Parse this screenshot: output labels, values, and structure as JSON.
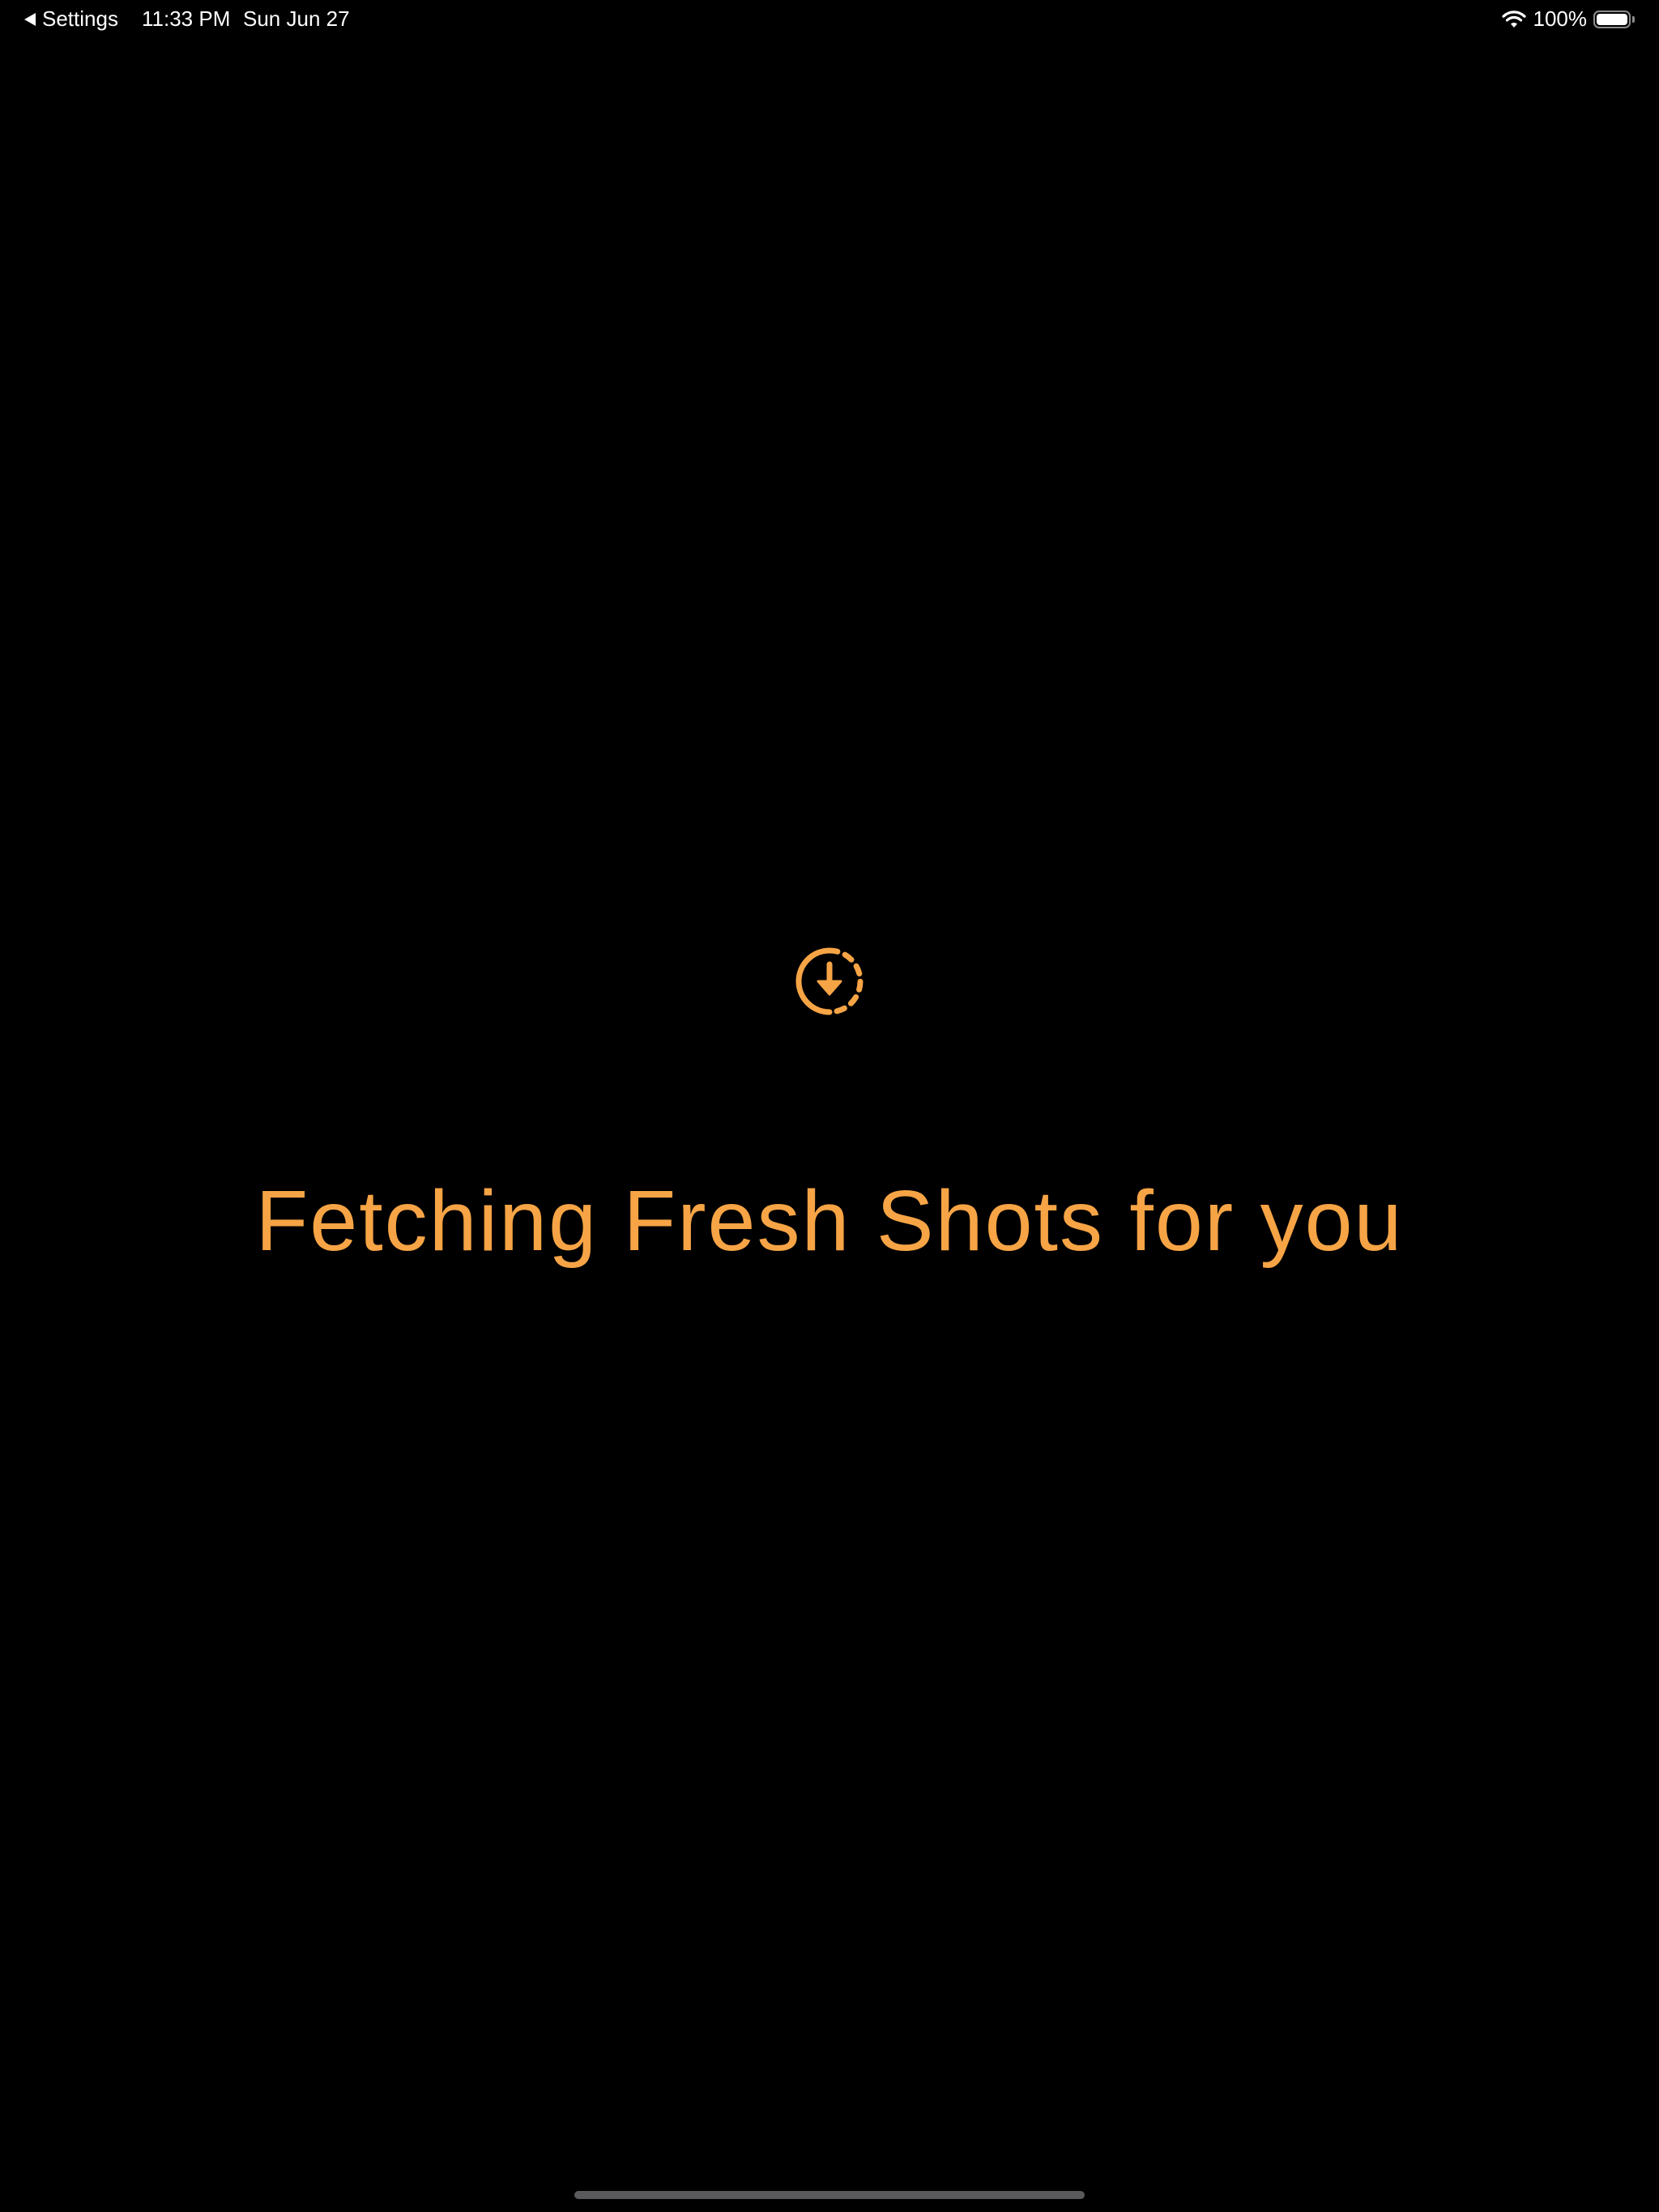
{
  "status_bar": {
    "back_label": "Settings",
    "time": "11:33 PM",
    "date": "Sun Jun 27",
    "battery_percent": "100%",
    "battery_level": 1.0,
    "wifi_icon": "wifi-icon",
    "battery_icon": "battery-icon"
  },
  "main": {
    "loader_icon": "dashed-circle-download-icon",
    "message": "Fetching Fresh Shots for you"
  },
  "colors": {
    "accent": "#F6A445",
    "background": "#000000",
    "status_text": "#FFFFFF"
  }
}
